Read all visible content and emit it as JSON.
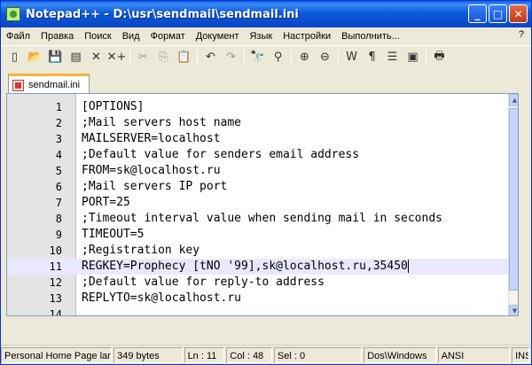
{
  "window": {
    "title": "Notepad++ - D:\\usr\\sendmail\\sendmail.ini",
    "minimize_glyph": "_",
    "maximize_glyph": "□",
    "close_glyph": "✕"
  },
  "menu": {
    "items": [
      "Файл",
      "Правка",
      "Поиск",
      "Вид",
      "Формат",
      "Документ",
      "Язык",
      "Настройки",
      "Выполнить..."
    ],
    "help": "?"
  },
  "toolbar": {
    "icons": [
      {
        "name": "new-file-icon",
        "glyph": "▯"
      },
      {
        "name": "open-file-icon",
        "glyph": "📂"
      },
      {
        "name": "save-icon",
        "glyph": "💾"
      },
      {
        "name": "save-all-icon",
        "glyph": "▤"
      },
      {
        "name": "close-icon",
        "glyph": "✕"
      },
      {
        "name": "close-all-icon",
        "glyph": "✕+"
      },
      {
        "name": "cut-icon",
        "glyph": "✂"
      },
      {
        "name": "copy-icon",
        "glyph": "⎘"
      },
      {
        "name": "paste-icon",
        "glyph": "📋"
      },
      {
        "name": "undo-icon",
        "glyph": "↶"
      },
      {
        "name": "redo-icon",
        "glyph": "↷"
      },
      {
        "name": "find-icon",
        "glyph": "🔭"
      },
      {
        "name": "replace-icon",
        "glyph": "⚲"
      },
      {
        "name": "zoom-in-icon",
        "glyph": "⊕"
      },
      {
        "name": "zoom-out-icon",
        "glyph": "⊖"
      },
      {
        "name": "word-wrap-icon",
        "glyph": "W"
      },
      {
        "name": "show-all-chars-icon",
        "glyph": "¶"
      },
      {
        "name": "indent-guide-icon",
        "glyph": "☰"
      },
      {
        "name": "doc-map-icon",
        "glyph": "▣"
      },
      {
        "name": "print-icon",
        "glyph": "🖶"
      }
    ]
  },
  "tab": {
    "label": "sendmail.ini"
  },
  "editor": {
    "lines": [
      {
        "num": "1",
        "text": "[OPTIONS]"
      },
      {
        "num": "2",
        "text": ";Mail servers host name"
      },
      {
        "num": "3",
        "text": "MAILSERVER=localhost"
      },
      {
        "num": "4",
        "text": ";Default value for senders email address"
      },
      {
        "num": "5",
        "text": "FROM=sk@localhost.ru"
      },
      {
        "num": "6",
        "text": ";Mail servers IP port"
      },
      {
        "num": "7",
        "text": "PORT=25"
      },
      {
        "num": "8",
        "text": ";Timeout interval value when sending mail in seconds"
      },
      {
        "num": "9",
        "text": "TIMEOUT=5"
      },
      {
        "num": "10",
        "text": ";Registration key"
      },
      {
        "num": "11",
        "text": "REGKEY=Prophecy [tNO '99],sk@localhost.ru,35450"
      },
      {
        "num": "12",
        "text": ";Default value for reply-to address"
      },
      {
        "num": "13",
        "text": "REPLYTO=sk@localhost.ru"
      },
      {
        "num": "14",
        "text": ""
      }
    ],
    "current_line_index": 10
  },
  "status": {
    "language": "Personal Home Page lang",
    "size": "349 bytes",
    "line": "Ln : 11",
    "col": "Col : 48",
    "sel": "Sel : 0",
    "eol": "Dos\\Windows",
    "encoding": "ANSI",
    "mode": "INS"
  }
}
